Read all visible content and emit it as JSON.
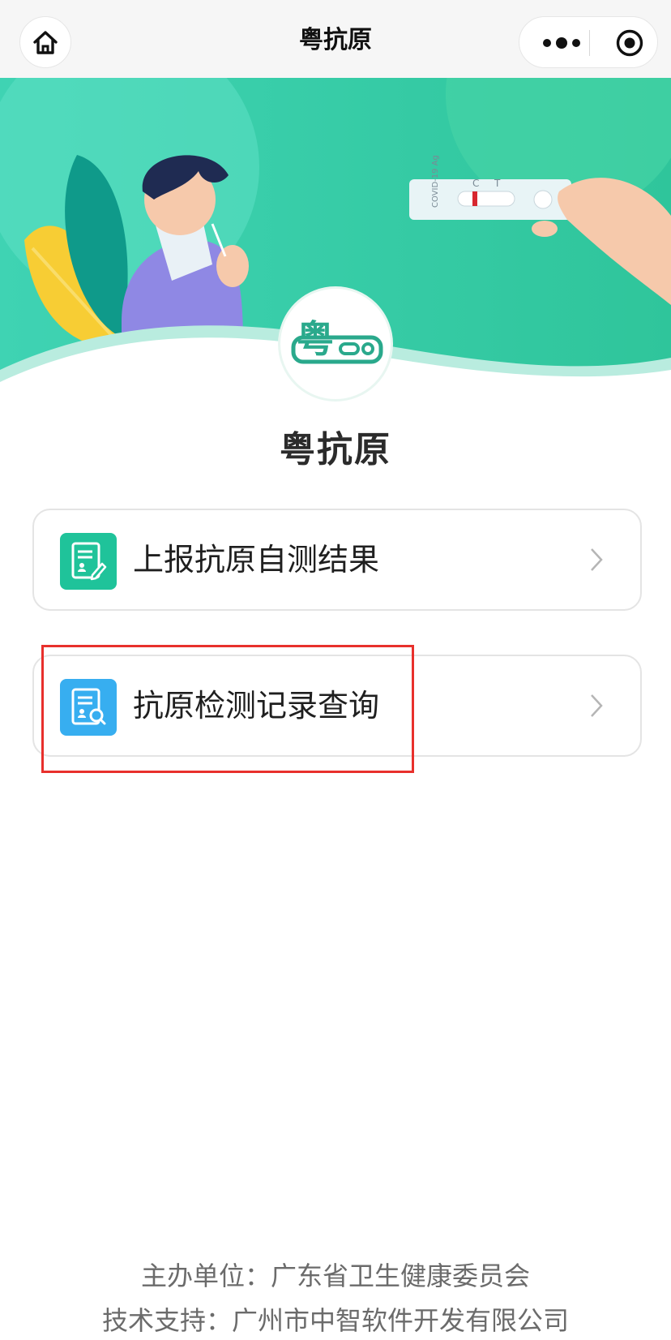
{
  "navbar": {
    "title": "粤抗原"
  },
  "app": {
    "name": "粤抗原"
  },
  "menu": {
    "items": [
      {
        "label": "上报抗原自测结果",
        "icon": "document-edit-icon",
        "color": "#1fc39a"
      },
      {
        "label": "抗原检测记录查询",
        "icon": "document-search-icon",
        "color": "#37aef0"
      }
    ]
  },
  "banner": {
    "test_kit_text": "COVID-19 Ag",
    "c_mark": "C",
    "t_mark": "T"
  },
  "footer": {
    "sponsor": "主办单位：广东省卫生健康委员会",
    "support": "技术支持：广州市中智软件开发有限公司"
  },
  "colors": {
    "banner_teal": "#34c9a5",
    "highlight_red": "#e8302c"
  }
}
